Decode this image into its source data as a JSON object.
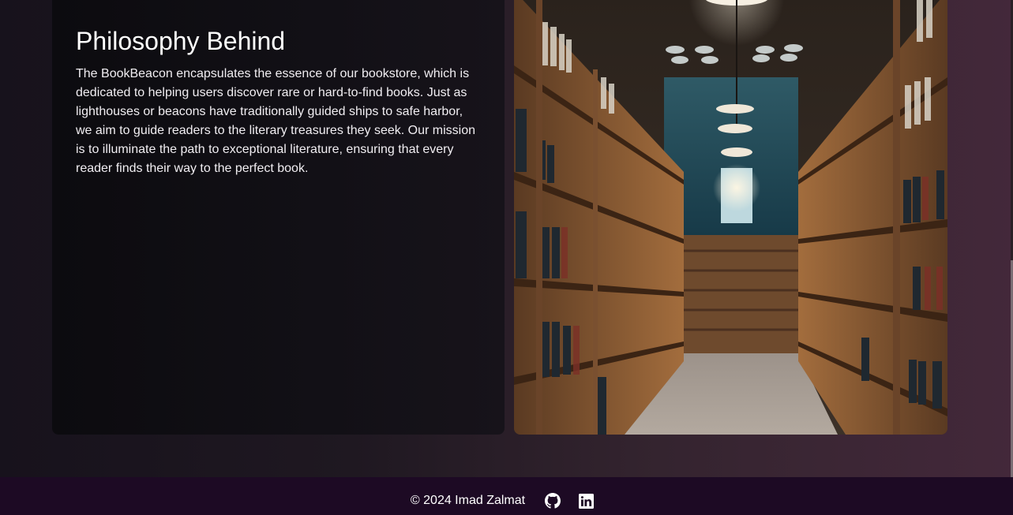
{
  "about": {
    "title": "Philosophy Behind",
    "body": "The BookBeacon encapsulates the essence of our bookstore, which is dedicated to helping users discover rare or hard-to-find books. Just as lighthouses or beacons have traditionally guided ships to safe harbor, we aim to guide readers to the literary treasures they seek. Our mission is to illuminate the path to exceptional literature, ensuring that every reader finds their way to the perfect book."
  },
  "footer": {
    "copyright": "© 2024 Imad Zalmat",
    "links": [
      {
        "name": "GitHub",
        "icon": "github-icon"
      },
      {
        "name": "LinkedIn",
        "icon": "linkedin-icon"
      }
    ]
  },
  "colors": {
    "footer_bg": "#1d0a24",
    "card_bg": "#0c0b0f",
    "text": "#ffffff"
  }
}
